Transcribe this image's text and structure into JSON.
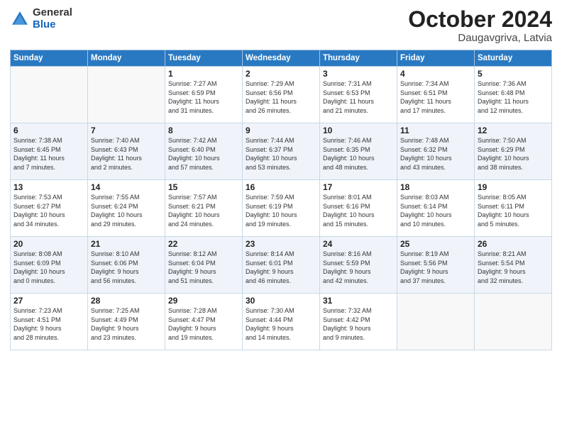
{
  "header": {
    "logo_general": "General",
    "logo_blue": "Blue",
    "month_title": "October 2024",
    "location": "Daugavgriva, Latvia"
  },
  "days_of_week": [
    "Sunday",
    "Monday",
    "Tuesday",
    "Wednesday",
    "Thursday",
    "Friday",
    "Saturday"
  ],
  "weeks": [
    [
      {
        "day": "",
        "info": ""
      },
      {
        "day": "",
        "info": ""
      },
      {
        "day": "1",
        "info": "Sunrise: 7:27 AM\nSunset: 6:59 PM\nDaylight: 11 hours\nand 31 minutes."
      },
      {
        "day": "2",
        "info": "Sunrise: 7:29 AM\nSunset: 6:56 PM\nDaylight: 11 hours\nand 26 minutes."
      },
      {
        "day": "3",
        "info": "Sunrise: 7:31 AM\nSunset: 6:53 PM\nDaylight: 11 hours\nand 21 minutes."
      },
      {
        "day": "4",
        "info": "Sunrise: 7:34 AM\nSunset: 6:51 PM\nDaylight: 11 hours\nand 17 minutes."
      },
      {
        "day": "5",
        "info": "Sunrise: 7:36 AM\nSunset: 6:48 PM\nDaylight: 11 hours\nand 12 minutes."
      }
    ],
    [
      {
        "day": "6",
        "info": "Sunrise: 7:38 AM\nSunset: 6:45 PM\nDaylight: 11 hours\nand 7 minutes."
      },
      {
        "day": "7",
        "info": "Sunrise: 7:40 AM\nSunset: 6:43 PM\nDaylight: 11 hours\nand 2 minutes."
      },
      {
        "day": "8",
        "info": "Sunrise: 7:42 AM\nSunset: 6:40 PM\nDaylight: 10 hours\nand 57 minutes."
      },
      {
        "day": "9",
        "info": "Sunrise: 7:44 AM\nSunset: 6:37 PM\nDaylight: 10 hours\nand 53 minutes."
      },
      {
        "day": "10",
        "info": "Sunrise: 7:46 AM\nSunset: 6:35 PM\nDaylight: 10 hours\nand 48 minutes."
      },
      {
        "day": "11",
        "info": "Sunrise: 7:48 AM\nSunset: 6:32 PM\nDaylight: 10 hours\nand 43 minutes."
      },
      {
        "day": "12",
        "info": "Sunrise: 7:50 AM\nSunset: 6:29 PM\nDaylight: 10 hours\nand 38 minutes."
      }
    ],
    [
      {
        "day": "13",
        "info": "Sunrise: 7:53 AM\nSunset: 6:27 PM\nDaylight: 10 hours\nand 34 minutes."
      },
      {
        "day": "14",
        "info": "Sunrise: 7:55 AM\nSunset: 6:24 PM\nDaylight: 10 hours\nand 29 minutes."
      },
      {
        "day": "15",
        "info": "Sunrise: 7:57 AM\nSunset: 6:21 PM\nDaylight: 10 hours\nand 24 minutes."
      },
      {
        "day": "16",
        "info": "Sunrise: 7:59 AM\nSunset: 6:19 PM\nDaylight: 10 hours\nand 19 minutes."
      },
      {
        "day": "17",
        "info": "Sunrise: 8:01 AM\nSunset: 6:16 PM\nDaylight: 10 hours\nand 15 minutes."
      },
      {
        "day": "18",
        "info": "Sunrise: 8:03 AM\nSunset: 6:14 PM\nDaylight: 10 hours\nand 10 minutes."
      },
      {
        "day": "19",
        "info": "Sunrise: 8:05 AM\nSunset: 6:11 PM\nDaylight: 10 hours\nand 5 minutes."
      }
    ],
    [
      {
        "day": "20",
        "info": "Sunrise: 8:08 AM\nSunset: 6:09 PM\nDaylight: 10 hours\nand 0 minutes."
      },
      {
        "day": "21",
        "info": "Sunrise: 8:10 AM\nSunset: 6:06 PM\nDaylight: 9 hours\nand 56 minutes."
      },
      {
        "day": "22",
        "info": "Sunrise: 8:12 AM\nSunset: 6:04 PM\nDaylight: 9 hours\nand 51 minutes."
      },
      {
        "day": "23",
        "info": "Sunrise: 8:14 AM\nSunset: 6:01 PM\nDaylight: 9 hours\nand 46 minutes."
      },
      {
        "day": "24",
        "info": "Sunrise: 8:16 AM\nSunset: 5:59 PM\nDaylight: 9 hours\nand 42 minutes."
      },
      {
        "day": "25",
        "info": "Sunrise: 8:19 AM\nSunset: 5:56 PM\nDaylight: 9 hours\nand 37 minutes."
      },
      {
        "day": "26",
        "info": "Sunrise: 8:21 AM\nSunset: 5:54 PM\nDaylight: 9 hours\nand 32 minutes."
      }
    ],
    [
      {
        "day": "27",
        "info": "Sunrise: 7:23 AM\nSunset: 4:51 PM\nDaylight: 9 hours\nand 28 minutes."
      },
      {
        "day": "28",
        "info": "Sunrise: 7:25 AM\nSunset: 4:49 PM\nDaylight: 9 hours\nand 23 minutes."
      },
      {
        "day": "29",
        "info": "Sunrise: 7:28 AM\nSunset: 4:47 PM\nDaylight: 9 hours\nand 19 minutes."
      },
      {
        "day": "30",
        "info": "Sunrise: 7:30 AM\nSunset: 4:44 PM\nDaylight: 9 hours\nand 14 minutes."
      },
      {
        "day": "31",
        "info": "Sunrise: 7:32 AM\nSunset: 4:42 PM\nDaylight: 9 hours\nand 9 minutes."
      },
      {
        "day": "",
        "info": ""
      },
      {
        "day": "",
        "info": ""
      }
    ]
  ]
}
